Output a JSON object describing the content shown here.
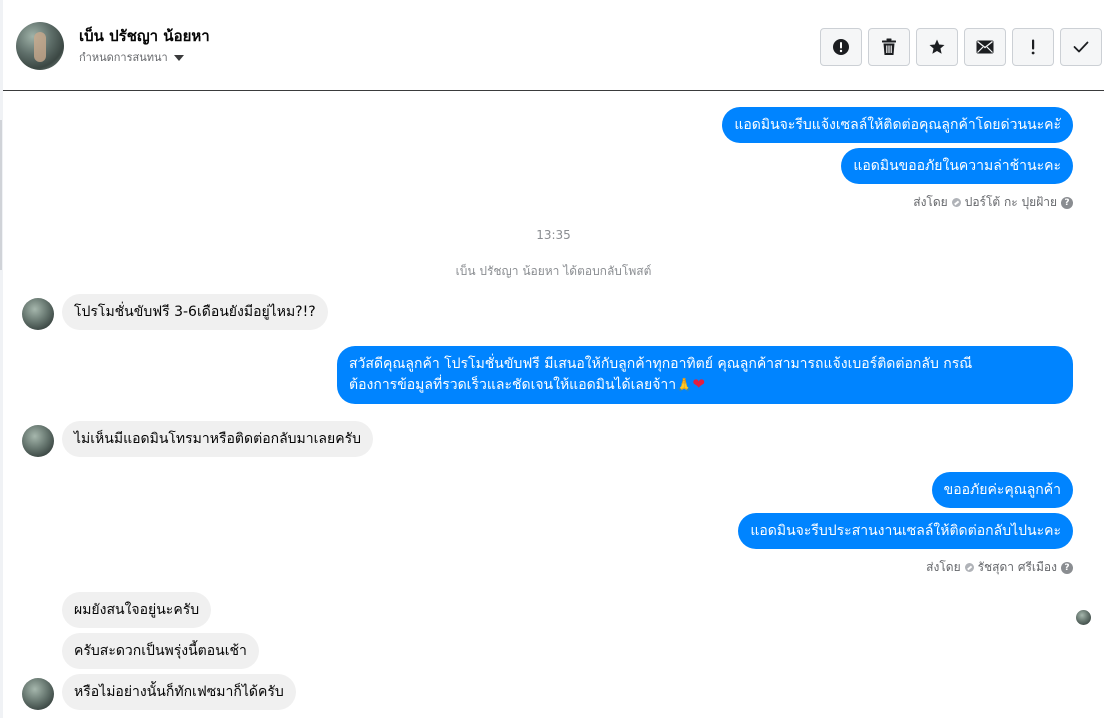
{
  "header": {
    "contact_name": "เบ็น ปรัชญา น้อยหา",
    "assign_label": "กำหนดการสนทนา",
    "actions": [
      {
        "name": "report-spam",
        "icon": "exclamation-circle-icon"
      },
      {
        "name": "delete",
        "icon": "trash-icon"
      },
      {
        "name": "star",
        "icon": "star-icon"
      },
      {
        "name": "mark-unread",
        "icon": "envelope-icon"
      },
      {
        "name": "follow-up",
        "icon": "exclamation-icon"
      },
      {
        "name": "mark-done",
        "icon": "checkmark-icon"
      }
    ]
  },
  "thread": {
    "out_1": "แอดมินจะรีบแจ้งเซลล์ให้ติดต่อคุณลูกค้าโดยด่วนนะคะั",
    "out_2": "แอดมินขออภัยในความล่าช้านะคะ",
    "sent_by_1": {
      "prefix": "ส่งโดย",
      "name": "ปอร์โต้ กะ ปุยฝ้าย"
    },
    "timestamp": "13:35",
    "system_note": "เบ็น ปรัชญา น้อยหา ได้ตอบกลับโพสต์",
    "in_1": "โปรโมชั่นขับฟรี 3-6เดือนยังมีอยู่ไหม?!?",
    "out_3_line1": "สวัสดีคุณลูกค้า โปรโมชั่นขับฟรี มีเสนอให้กับลูกค้าทุกอาทิตย์ คุณลูกค้าสามารถแจ้งเบอร์ติดต่อกลับ กรณี",
    "out_3_line2": "ต้องการข้อมูลที่รวดเร็วและชัดเจนให้แอดมินได้เลยจ้าา",
    "in_2": "ไม่เห็นมีแอดมินโทรมาหรือติดต่อกลับมาเลยครับ",
    "out_4": "ขออภัยค่ะคุณลูกค้า",
    "out_5": "แอดมินจะรีบประสานงานเซลล์ให้ติดต่อกลับไปนะคะ",
    "sent_by_2": {
      "prefix": "ส่งโดย",
      "name": "รัชสุดา ศรีเมือง"
    },
    "in_3": "ผมยังสนใจอยู่นะครับ",
    "in_4": "ครับสะดวกเป็นพรุ่งนี้ตอนเช้า",
    "in_5": "หรือไม่อย่างนั้นก็ทักเฟซมาก็ได้ครับ"
  },
  "colors": {
    "outgoing_bubble": "#0084ff",
    "incoming_bubble": "#f0f0f0",
    "meta_text": "#65676b"
  }
}
